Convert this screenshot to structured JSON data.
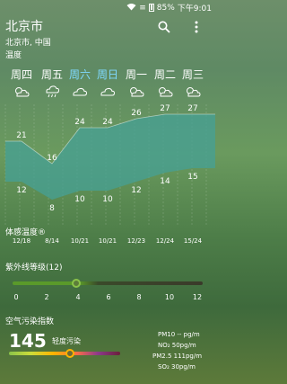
{
  "status": {
    "signal": "≡",
    "wifi": "wifi-icon",
    "battery": "85%",
    "time": "下午9:01"
  },
  "header": {
    "city": "北京市",
    "location": "北京市, 中国"
  },
  "sections": {
    "temperature": "温度",
    "feels_like": "体感温度®",
    "uv": "紫外线等级(12)",
    "aqi": "空气污染指数"
  },
  "days": [
    {
      "label": "周四",
      "highlight": false,
      "icon": "partly-cloudy-icon"
    },
    {
      "label": "周五",
      "highlight": false,
      "icon": "rain-icon"
    },
    {
      "label": "周六",
      "highlight": true,
      "icon": "cloudy-icon"
    },
    {
      "label": "周日",
      "highlight": true,
      "icon": "cloudy-icon"
    },
    {
      "label": "周一",
      "highlight": false,
      "icon": "partly-cloudy-icon"
    },
    {
      "label": "周二",
      "highlight": false,
      "icon": "partly-cloudy-icon"
    },
    {
      "label": "周三",
      "highlight": false,
      "icon": "partly-cloudy-icon"
    }
  ],
  "chart_data": {
    "type": "area",
    "categories": [
      "周四",
      "周五",
      "周六",
      "周日",
      "周一",
      "周二",
      "周三"
    ],
    "series": [
      {
        "values": [
          21,
          16,
          24,
          24,
          26,
          27,
          27
        ]
      },
      {
        "values": [
          12,
          8,
          10,
          10,
          12,
          14,
          15
        ]
      }
    ]
  },
  "feels_like": [
    "12/18",
    "8/14",
    "10/21",
    "10/21",
    "12/23",
    "12/24",
    "15/24"
  ],
  "uv": {
    "ticks": [
      "0",
      "2",
      "4",
      "6",
      "8",
      "10",
      "12"
    ],
    "level": 4
  },
  "aqi": {
    "value": "145",
    "label": "轻度污染",
    "pm10": "PM10 -- pg/m",
    "no2": "NO₂  50pg/m",
    "pm25": "PM2.5  111pg/m",
    "so2": "SO₂  30pg/m"
  }
}
